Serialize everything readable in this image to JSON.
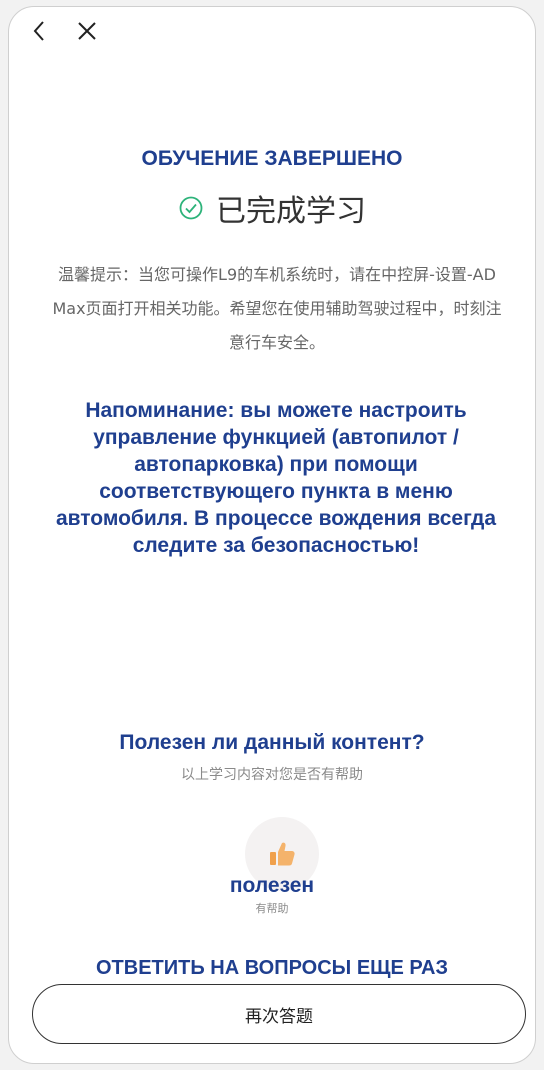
{
  "nav": {
    "back_icon": "chevron-left-icon",
    "close_icon": "close-icon"
  },
  "header": {
    "title_ru": "ОБУЧЕНИЕ ЗАВЕРШЕНО",
    "done_label": "已完成学习",
    "done_icon": "check-circle-icon"
  },
  "notice": {
    "text_cn": "温馨提示：当您可操作L9的车机系统时，请在中控屏-设置-AD Max页面打开相关功能。希望您在使用辅助驾驶过程中，时刻注意行车安全。",
    "text_ru": "Напоминание: вы можете настроить управление функцией (автопилот / автопарковка) при помощи соответствующего пункта в меню автомобиля. В процессе вождения всегда следите за безопасностью!"
  },
  "feedback": {
    "question_ru": "Полезен ли данный контент?",
    "question_cn": "以上学习内容对您是否有帮助",
    "like_icon": "thumbs-up-icon",
    "like_label_ru": "полезен",
    "like_label_cn": "有帮助"
  },
  "retry": {
    "label_ru": "ОТВЕТИТЬ НА ВОПРОСЫ ЕЩЕ РАЗ",
    "button_cn": "再次答题"
  },
  "colors": {
    "accent_ru_text": "#1f3f8f",
    "check_green": "#2db37a",
    "thumb_orange": "#f0a04b"
  }
}
